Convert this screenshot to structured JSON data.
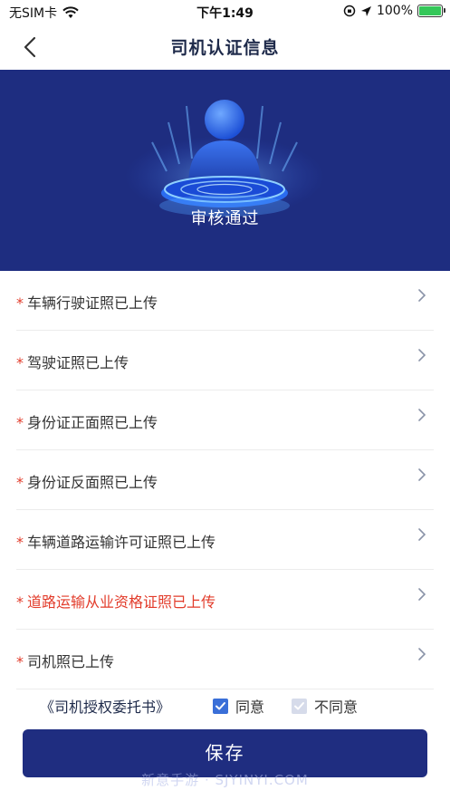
{
  "status_bar": {
    "carrier": "无SIM卡",
    "time": "下午1:49",
    "battery": "100%"
  },
  "nav": {
    "title": "司机认证信息"
  },
  "hero": {
    "status_text": "审核通过"
  },
  "documents": [
    {
      "label": "车辆行驶证照已上传",
      "required": "*",
      "highlight": false
    },
    {
      "label": "驾驶证照已上传",
      "required": "*",
      "highlight": false
    },
    {
      "label": "身份证正面照已上传",
      "required": "*",
      "highlight": false
    },
    {
      "label": "身份证反面照已上传",
      "required": "*",
      "highlight": false
    },
    {
      "label": "车辆道路运输许可证照已上传",
      "required": "*",
      "highlight": false
    },
    {
      "label": "道路运输从业资格证照已上传",
      "required": "*",
      "highlight": true
    },
    {
      "label": "司机照已上传",
      "required": "*",
      "highlight": false
    }
  ],
  "agreement": {
    "doc_link": "《司机授权委托书》",
    "agree_label": "同意",
    "disagree_label": "不同意"
  },
  "save_button": {
    "label": "保存"
  },
  "watermark": "新意手游 · SJYINYI.COM",
  "colors": {
    "primary": "#1f2d80",
    "required_mark": "#e23b2a",
    "checkbox_checked": "#3a6fd8",
    "checkbox_unchecked": "#d6dbea"
  }
}
